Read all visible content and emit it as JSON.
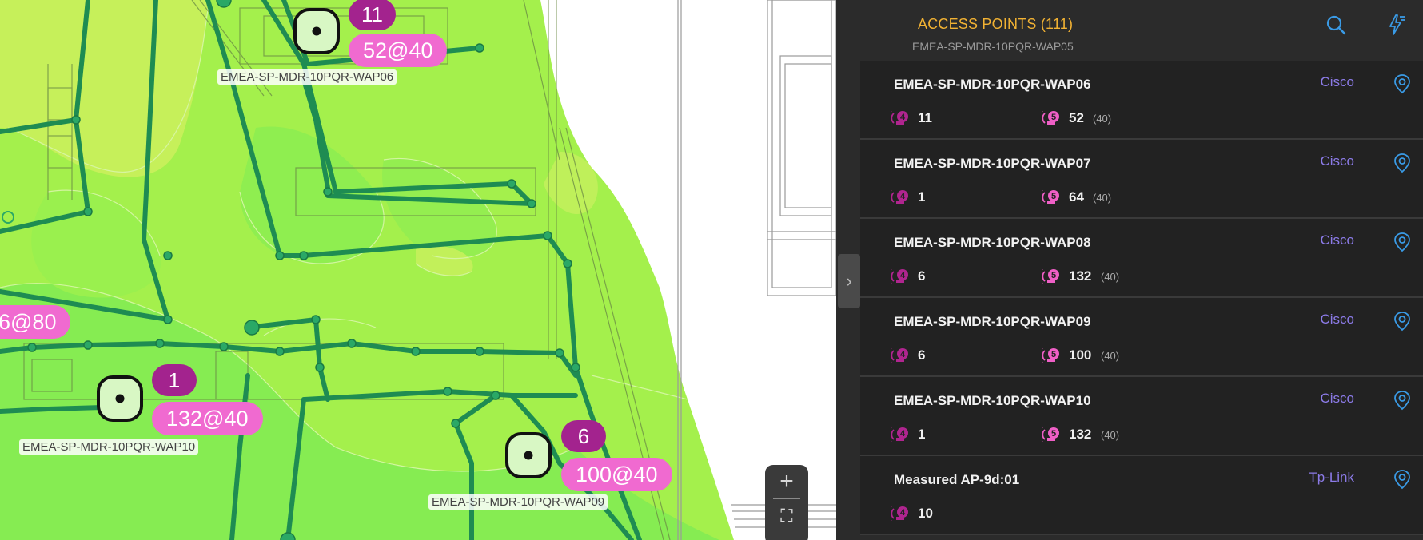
{
  "map": {
    "access_points": [
      {
        "id": "wap06",
        "name": "EMEA-SP-MDR-10PQR-WAP06",
        "clients_24": "11",
        "clients_5": "52@40"
      },
      {
        "id": "wap10",
        "name": "EMEA-SP-MDR-10PQR-WAP10",
        "clients_24": "1",
        "clients_5": "132@40"
      },
      {
        "id": "wap09",
        "name": "EMEA-SP-MDR-10PQR-WAP09",
        "clients_24": "6",
        "clients_5": "100@40"
      },
      {
        "id": "partial",
        "clients_5": "6@80"
      }
    ],
    "zoom": {
      "in_glyph": "+",
      "fit_glyph": "⛶"
    }
  },
  "panel": {
    "title": "ACCESS POINTS (111)",
    "collapse_glyph": "›",
    "peek_text": "EMEA-SP-MDR-10PQR-WAP05",
    "header_icons": [
      "search-icon",
      "bolt-filter-icon",
      "more-icon"
    ],
    "colors": {
      "title": "#f2b233",
      "vendor": "#8c7be8",
      "pin": "#3a9be6",
      "band24": "#b0258f",
      "band5": "#ef5fc6"
    },
    "rows": [
      {
        "name": "EMEA-SP-MDR-10PQR-WAP06",
        "vendor": "Cisco",
        "clients_24": "11",
        "clients_5": "52",
        "channel": "(40)"
      },
      {
        "name": "EMEA-SP-MDR-10PQR-WAP07",
        "vendor": "Cisco",
        "clients_24": "1",
        "clients_5": "64",
        "channel": "(40)"
      },
      {
        "name": "EMEA-SP-MDR-10PQR-WAP08",
        "vendor": "Cisco",
        "clients_24": "6",
        "clients_5": "132",
        "channel": "(40)"
      },
      {
        "name": "EMEA-SP-MDR-10PQR-WAP09",
        "vendor": "Cisco",
        "clients_24": "6",
        "clients_5": "100",
        "channel": "(40)"
      },
      {
        "name": "EMEA-SP-MDR-10PQR-WAP10",
        "vendor": "Cisco",
        "clients_24": "1",
        "clients_5": "132",
        "channel": "(40)"
      },
      {
        "name": "Measured AP-9d:01",
        "vendor": "Tp-Link",
        "clients_24": "10"
      }
    ]
  }
}
